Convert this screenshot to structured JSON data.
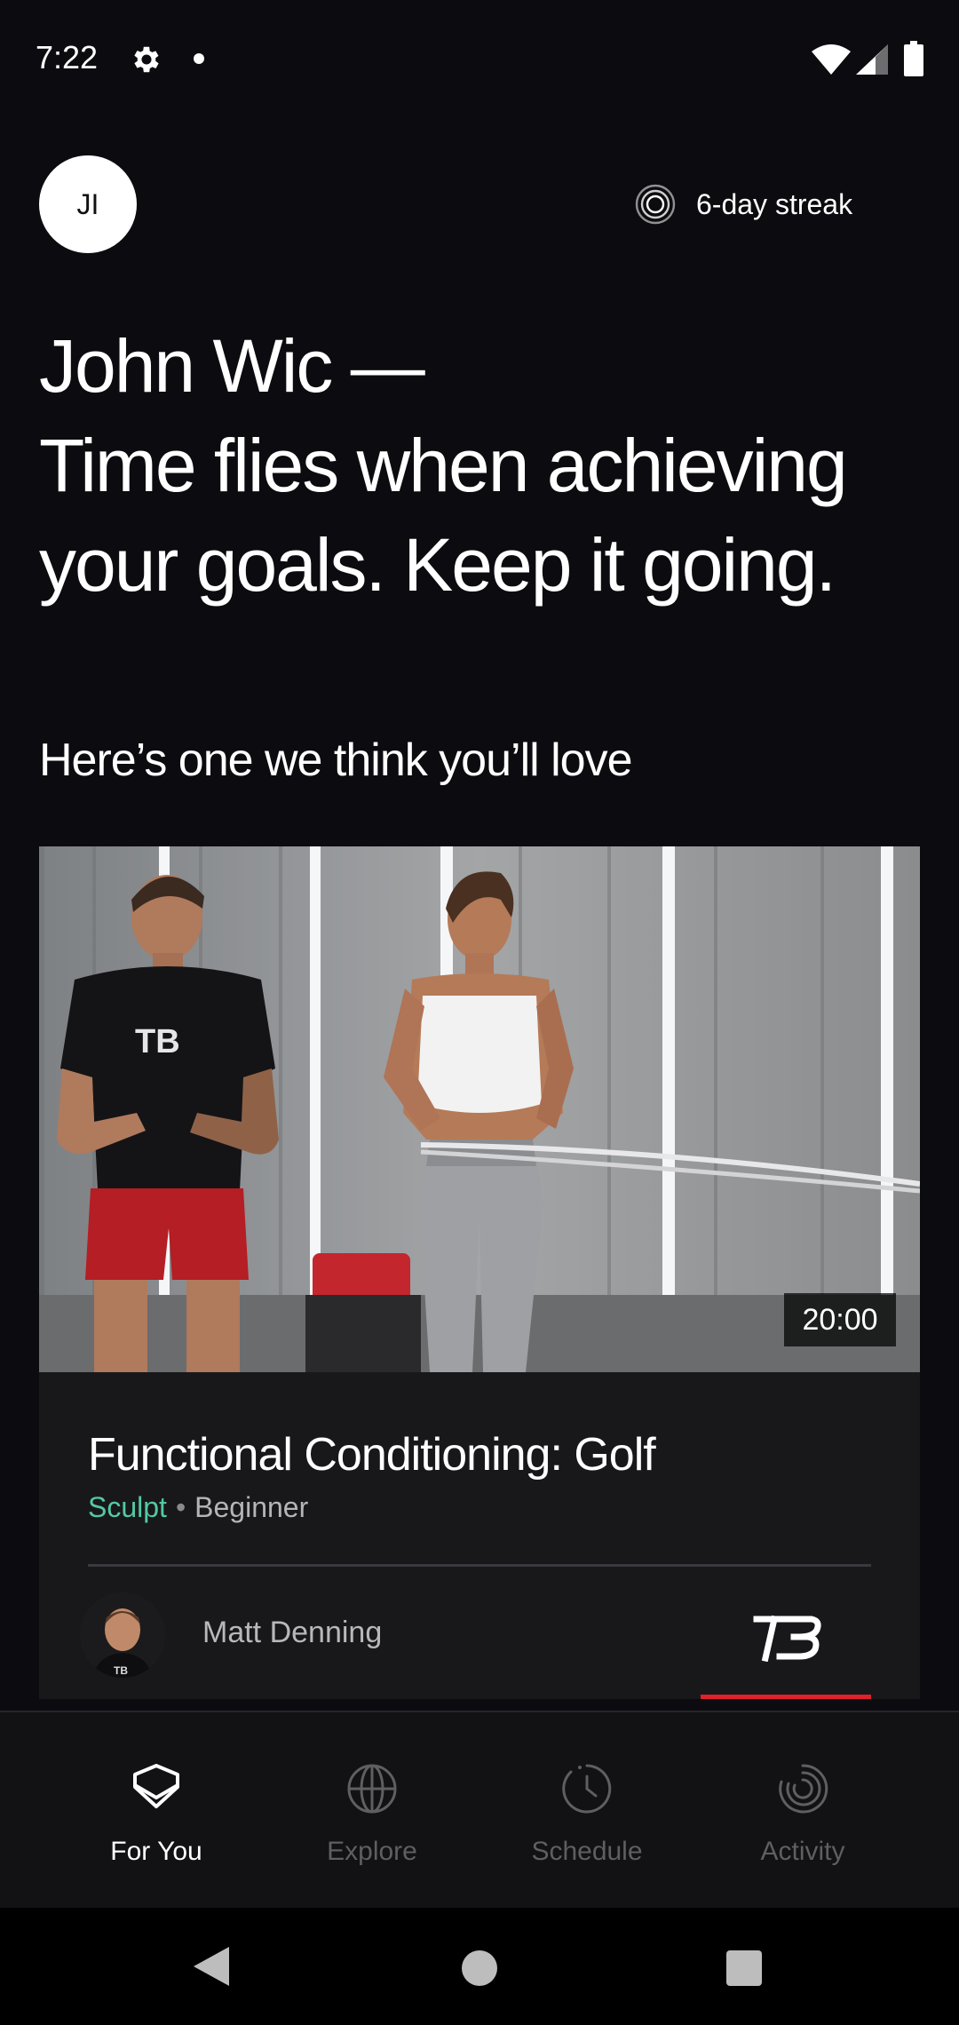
{
  "status_bar": {
    "time": "7:22",
    "icons": [
      "settings-icon",
      "notification-dot-icon",
      "wifi-icon",
      "signal-icon",
      "battery-icon"
    ]
  },
  "header": {
    "avatar_initials": "JI",
    "streak_label": "6-day streak",
    "streak_icon": "streak-rings-icon"
  },
  "greeting": {
    "line1": "John Wic —",
    "line2": "Time flies when achieving",
    "line3": "your goals. Keep it going."
  },
  "section": {
    "title": "Here’s one we think you’ll love"
  },
  "workout_card": {
    "duration": "20:00",
    "title": "Functional Conditioning: Golf",
    "category": "Sculpt",
    "separator": "•",
    "level": "Beginner",
    "trainer_name": "Matt Denning",
    "brand_logo": "TB12",
    "accent_color": "#55c8a4",
    "brand_color": "#e0202a"
  },
  "bottom_nav": {
    "items": [
      {
        "label": "For You",
        "icon": "for-you-icon",
        "active": true
      },
      {
        "label": "Explore",
        "icon": "globe-icon",
        "active": false
      },
      {
        "label": "Schedule",
        "icon": "clock-icon",
        "active": false
      },
      {
        "label": "Activity",
        "icon": "activity-rings-icon",
        "active": false
      }
    ]
  },
  "system_nav": {
    "icons": [
      "back-icon",
      "home-icon",
      "recents-icon"
    ]
  }
}
